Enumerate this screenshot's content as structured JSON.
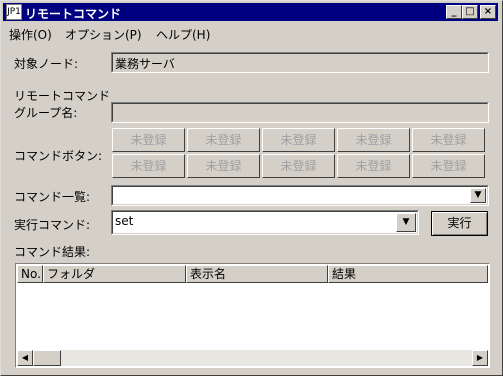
{
  "window": {
    "title": "リモートコマンド",
    "app_icon": "JP1",
    "min_label": "_",
    "max_label": "□",
    "close_label": "×"
  },
  "menu": [
    {
      "label": "操作(O)"
    },
    {
      "label": "オプション(P)"
    },
    {
      "label": "ヘルプ(H)"
    }
  ],
  "target_node": {
    "label": "対象ノード:",
    "value": "業務サーバ"
  },
  "remote_group": {
    "label_line1": "リモートコマンド",
    "label_line2": "グループ名:",
    "value": ""
  },
  "command_buttons": {
    "label": "コマンドボタン:",
    "row1": [
      "未登録",
      "未登録",
      "未登録",
      "未登録",
      "未登録"
    ],
    "row2": [
      "未登録",
      "未登録",
      "未登録",
      "未登録",
      "未登録"
    ]
  },
  "command_list": {
    "label": "コマンド一覧:",
    "value": ""
  },
  "exec_command": {
    "label": "実行コマンド:",
    "value": "set",
    "button_label": "実行"
  },
  "results": {
    "label": "コマンド結果:",
    "columns": [
      "No.",
      "フォルダ",
      "表示名",
      "結果"
    ]
  },
  "icons": {
    "dropdown": "▼",
    "scroll_left": "◀",
    "scroll_right": "▶"
  }
}
